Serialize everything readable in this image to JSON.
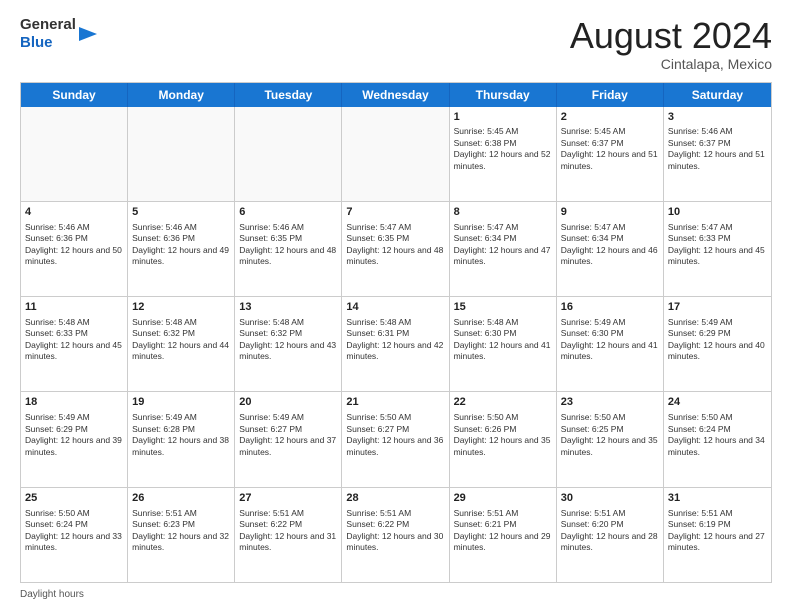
{
  "logo": {
    "line1": "General",
    "line2": "Blue"
  },
  "title": "August 2024",
  "location": "Cintalapa, Mexico",
  "footer": "Daylight hours",
  "header_days": [
    "Sunday",
    "Monday",
    "Tuesday",
    "Wednesday",
    "Thursday",
    "Friday",
    "Saturday"
  ],
  "weeks": [
    [
      {
        "day": "",
        "sunrise": "",
        "sunset": "",
        "daylight": ""
      },
      {
        "day": "",
        "sunrise": "",
        "sunset": "",
        "daylight": ""
      },
      {
        "day": "",
        "sunrise": "",
        "sunset": "",
        "daylight": ""
      },
      {
        "day": "",
        "sunrise": "",
        "sunset": "",
        "daylight": ""
      },
      {
        "day": "1",
        "sunrise": "Sunrise: 5:45 AM",
        "sunset": "Sunset: 6:38 PM",
        "daylight": "Daylight: 12 hours and 52 minutes."
      },
      {
        "day": "2",
        "sunrise": "Sunrise: 5:45 AM",
        "sunset": "Sunset: 6:37 PM",
        "daylight": "Daylight: 12 hours and 51 minutes."
      },
      {
        "day": "3",
        "sunrise": "Sunrise: 5:46 AM",
        "sunset": "Sunset: 6:37 PM",
        "daylight": "Daylight: 12 hours and 51 minutes."
      }
    ],
    [
      {
        "day": "4",
        "sunrise": "Sunrise: 5:46 AM",
        "sunset": "Sunset: 6:36 PM",
        "daylight": "Daylight: 12 hours and 50 minutes."
      },
      {
        "day": "5",
        "sunrise": "Sunrise: 5:46 AM",
        "sunset": "Sunset: 6:36 PM",
        "daylight": "Daylight: 12 hours and 49 minutes."
      },
      {
        "day": "6",
        "sunrise": "Sunrise: 5:46 AM",
        "sunset": "Sunset: 6:35 PM",
        "daylight": "Daylight: 12 hours and 48 minutes."
      },
      {
        "day": "7",
        "sunrise": "Sunrise: 5:47 AM",
        "sunset": "Sunset: 6:35 PM",
        "daylight": "Daylight: 12 hours and 48 minutes."
      },
      {
        "day": "8",
        "sunrise": "Sunrise: 5:47 AM",
        "sunset": "Sunset: 6:34 PM",
        "daylight": "Daylight: 12 hours and 47 minutes."
      },
      {
        "day": "9",
        "sunrise": "Sunrise: 5:47 AM",
        "sunset": "Sunset: 6:34 PM",
        "daylight": "Daylight: 12 hours and 46 minutes."
      },
      {
        "day": "10",
        "sunrise": "Sunrise: 5:47 AM",
        "sunset": "Sunset: 6:33 PM",
        "daylight": "Daylight: 12 hours and 45 minutes."
      }
    ],
    [
      {
        "day": "11",
        "sunrise": "Sunrise: 5:48 AM",
        "sunset": "Sunset: 6:33 PM",
        "daylight": "Daylight: 12 hours and 45 minutes."
      },
      {
        "day": "12",
        "sunrise": "Sunrise: 5:48 AM",
        "sunset": "Sunset: 6:32 PM",
        "daylight": "Daylight: 12 hours and 44 minutes."
      },
      {
        "day": "13",
        "sunrise": "Sunrise: 5:48 AM",
        "sunset": "Sunset: 6:32 PM",
        "daylight": "Daylight: 12 hours and 43 minutes."
      },
      {
        "day": "14",
        "sunrise": "Sunrise: 5:48 AM",
        "sunset": "Sunset: 6:31 PM",
        "daylight": "Daylight: 12 hours and 42 minutes."
      },
      {
        "day": "15",
        "sunrise": "Sunrise: 5:48 AM",
        "sunset": "Sunset: 6:30 PM",
        "daylight": "Daylight: 12 hours and 41 minutes."
      },
      {
        "day": "16",
        "sunrise": "Sunrise: 5:49 AM",
        "sunset": "Sunset: 6:30 PM",
        "daylight": "Daylight: 12 hours and 41 minutes."
      },
      {
        "day": "17",
        "sunrise": "Sunrise: 5:49 AM",
        "sunset": "Sunset: 6:29 PM",
        "daylight": "Daylight: 12 hours and 40 minutes."
      }
    ],
    [
      {
        "day": "18",
        "sunrise": "Sunrise: 5:49 AM",
        "sunset": "Sunset: 6:29 PM",
        "daylight": "Daylight: 12 hours and 39 minutes."
      },
      {
        "day": "19",
        "sunrise": "Sunrise: 5:49 AM",
        "sunset": "Sunset: 6:28 PM",
        "daylight": "Daylight: 12 hours and 38 minutes."
      },
      {
        "day": "20",
        "sunrise": "Sunrise: 5:49 AM",
        "sunset": "Sunset: 6:27 PM",
        "daylight": "Daylight: 12 hours and 37 minutes."
      },
      {
        "day": "21",
        "sunrise": "Sunrise: 5:50 AM",
        "sunset": "Sunset: 6:27 PM",
        "daylight": "Daylight: 12 hours and 36 minutes."
      },
      {
        "day": "22",
        "sunrise": "Sunrise: 5:50 AM",
        "sunset": "Sunset: 6:26 PM",
        "daylight": "Daylight: 12 hours and 35 minutes."
      },
      {
        "day": "23",
        "sunrise": "Sunrise: 5:50 AM",
        "sunset": "Sunset: 6:25 PM",
        "daylight": "Daylight: 12 hours and 35 minutes."
      },
      {
        "day": "24",
        "sunrise": "Sunrise: 5:50 AM",
        "sunset": "Sunset: 6:24 PM",
        "daylight": "Daylight: 12 hours and 34 minutes."
      }
    ],
    [
      {
        "day": "25",
        "sunrise": "Sunrise: 5:50 AM",
        "sunset": "Sunset: 6:24 PM",
        "daylight": "Daylight: 12 hours and 33 minutes."
      },
      {
        "day": "26",
        "sunrise": "Sunrise: 5:51 AM",
        "sunset": "Sunset: 6:23 PM",
        "daylight": "Daylight: 12 hours and 32 minutes."
      },
      {
        "day": "27",
        "sunrise": "Sunrise: 5:51 AM",
        "sunset": "Sunset: 6:22 PM",
        "daylight": "Daylight: 12 hours and 31 minutes."
      },
      {
        "day": "28",
        "sunrise": "Sunrise: 5:51 AM",
        "sunset": "Sunset: 6:22 PM",
        "daylight": "Daylight: 12 hours and 30 minutes."
      },
      {
        "day": "29",
        "sunrise": "Sunrise: 5:51 AM",
        "sunset": "Sunset: 6:21 PM",
        "daylight": "Daylight: 12 hours and 29 minutes."
      },
      {
        "day": "30",
        "sunrise": "Sunrise: 5:51 AM",
        "sunset": "Sunset: 6:20 PM",
        "daylight": "Daylight: 12 hours and 28 minutes."
      },
      {
        "day": "31",
        "sunrise": "Sunrise: 5:51 AM",
        "sunset": "Sunset: 6:19 PM",
        "daylight": "Daylight: 12 hours and 27 minutes."
      }
    ]
  ]
}
